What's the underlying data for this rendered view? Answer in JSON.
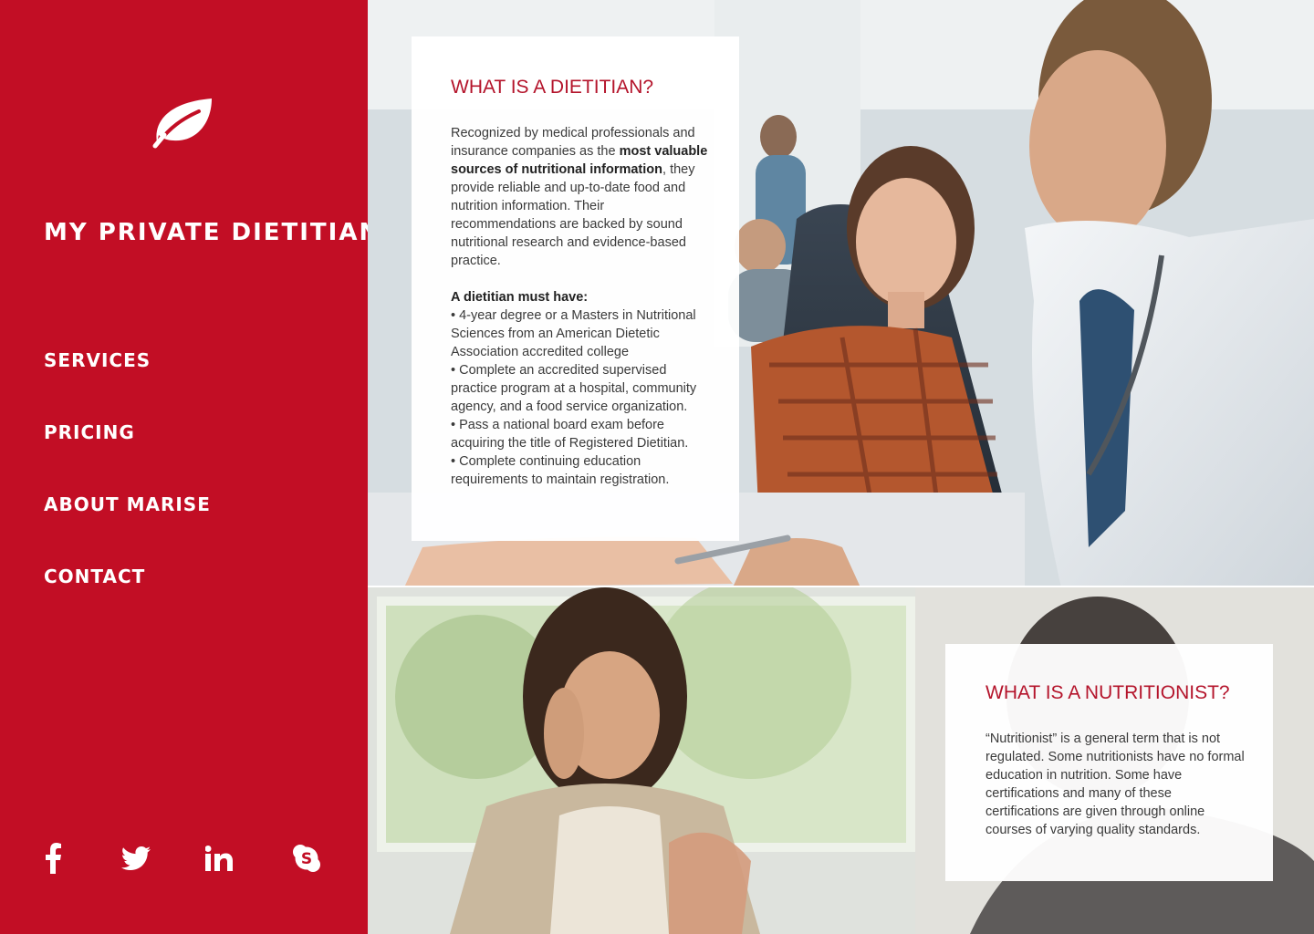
{
  "brand": {
    "name": "MY PRIVATE DIETITIAN",
    "logo_icon": "leaf-icon"
  },
  "nav": [
    "SERVICES",
    "PRICING",
    "ABOUT MARISE",
    "CONTACT"
  ],
  "social": [
    {
      "name": "facebook-icon",
      "glyph": "f"
    },
    {
      "name": "twitter-icon",
      "glyph": "twitter"
    },
    {
      "name": "linkedin-icon",
      "glyph": "in"
    },
    {
      "name": "skype-icon",
      "glyph": "S"
    }
  ],
  "colors": {
    "accent": "#c20e25",
    "heading": "#b4142b"
  },
  "dietitian": {
    "title": "WHAT IS A DIETITIAN?",
    "intro_1": "Recognized by medical professionals and insurance companies as the ",
    "intro_bold": "most valuable sources of nutritional information",
    "intro_2": ", they provide reliable and up-to-date food and nutrition information. Their recommendations are backed by sound nutritional research and evidence-based practice.",
    "must_have_label": "A dietitian must have:",
    "requirements": [
      "• 4-year degree or a Masters in Nutritional Sciences from an American Dietetic Association accredited college",
      "• Complete an accredited supervised practice program at a hospital, community agency, and a food service organization.",
      "• Pass a national board exam before acquiring the title of Registered Dietitian.",
      "• Complete continuing education requirements to maintain registration."
    ]
  },
  "nutritionist": {
    "title": "WHAT IS A NUTRITIONIST?",
    "body": "“Nutritionist” is a general term that is not regulated. Some nutritionists have no formal education in nutrition. Some have certifications and many of these certifications are given through online courses of varying quality standards."
  }
}
